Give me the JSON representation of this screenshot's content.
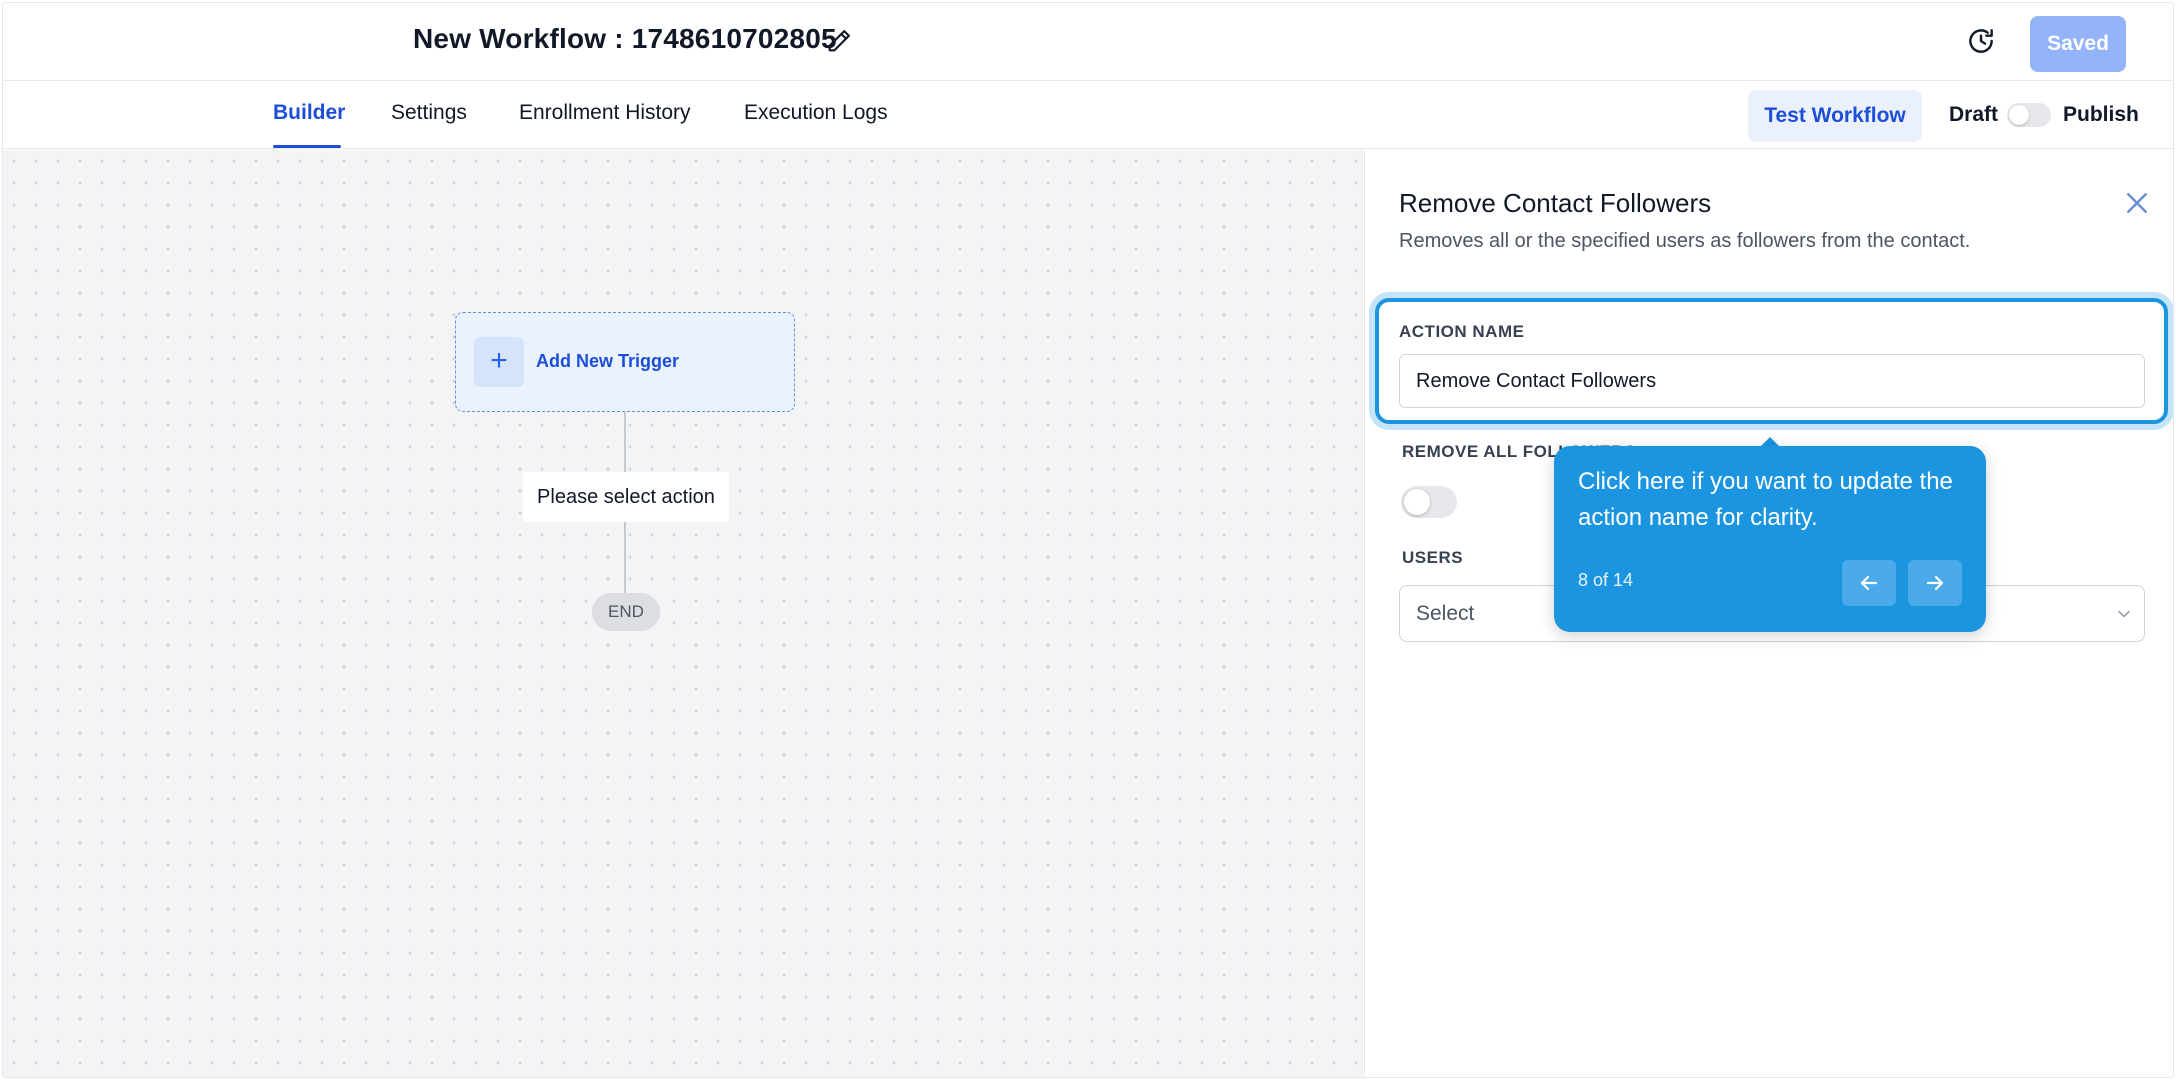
{
  "header": {
    "workflow_title": "New Workflow : 1748610702805",
    "saved_label": "Saved"
  },
  "tabs": [
    {
      "label": "Builder",
      "active": true
    },
    {
      "label": "Settings",
      "active": false
    },
    {
      "label": "Enrollment History",
      "active": false
    },
    {
      "label": "Execution Logs",
      "active": false
    }
  ],
  "toolbar": {
    "test_workflow_label": "Test Workflow",
    "draft_label": "Draft",
    "publish_label": "Publish",
    "published": false
  },
  "canvas": {
    "trigger_label": "Add New Trigger",
    "action_placeholder": "Please select action",
    "end_label": "END"
  },
  "panel": {
    "title": "Remove Contact Followers",
    "description": "Removes all or the specified users as followers from the contact.",
    "action_name_label": "ACTION NAME",
    "action_name_value": "Remove Contact Followers",
    "remove_all_label": "REMOVE ALL FOLLOWERS",
    "remove_all_enabled": false,
    "users_label": "USERS",
    "users_value": "Select"
  },
  "tooltip": {
    "text": "Click here if you want to update the action name for clarity.",
    "step": "8 of 14"
  },
  "colors": {
    "accent": "#1d4ed8",
    "tooltip": "#1b95e0",
    "saved_button": "#93b4f8"
  },
  "icons": {
    "edit": "pencil-icon",
    "history": "history-icon",
    "close": "close-icon",
    "plus": "plus-icon",
    "chevron": "chevron-down-icon",
    "prev": "arrow-left-icon",
    "next": "arrow-right-icon"
  }
}
